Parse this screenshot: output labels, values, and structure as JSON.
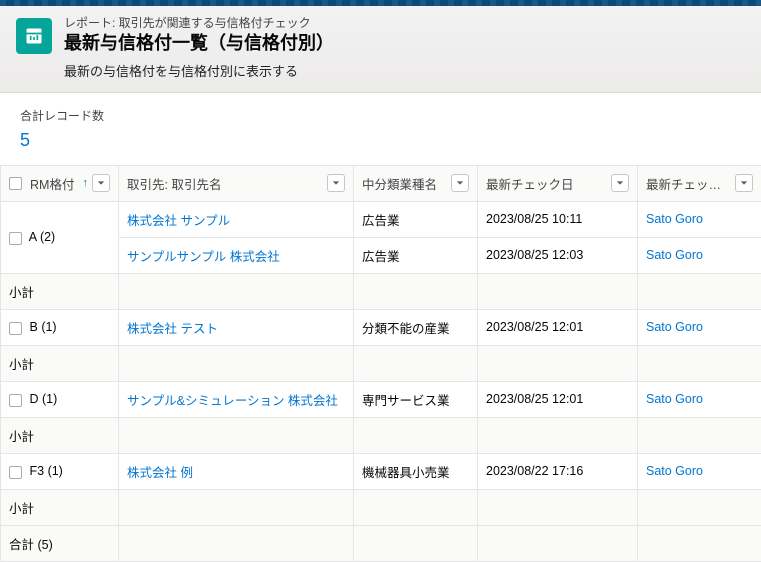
{
  "header": {
    "eyebrow": "レポート: 取引先が関連する与信格付チェック",
    "title": "最新与信格付一覧（与信格付別）",
    "desc": "最新の与信格付を与信格付別に表示する"
  },
  "summary": {
    "label": "合計レコード数",
    "value": "5"
  },
  "columns": {
    "c1": "RM格付",
    "c2": "取引先: 取引先名",
    "c3": "中分類業種名",
    "c4": "最新チェック日",
    "c5": "最新チェックユーザ"
  },
  "labels": {
    "subtotal": "小計",
    "total": "合計"
  },
  "total": {
    "count": "(5)"
  },
  "groups": [
    {
      "name": "A",
      "count": "(2)",
      "rows": [
        {
          "account": "株式会社 サンプル",
          "industry": "広告業",
          "checked": "2023/08/25 10:11",
          "user": "Sato Goro"
        },
        {
          "account": "サンプルサンプル  株式会社",
          "industry": "広告業",
          "checked": "2023/08/25 12:03",
          "user": "Sato Goro"
        }
      ]
    },
    {
      "name": "B",
      "count": "(1)",
      "rows": [
        {
          "account": "株式会社 テスト",
          "industry": "分類不能の産業",
          "checked": "2023/08/25 12:01",
          "user": "Sato Goro"
        }
      ]
    },
    {
      "name": "D",
      "count": "(1)",
      "rows": [
        {
          "account": "サンプル&シミュレーション  株式会社",
          "industry": "専門サービス業",
          "checked": "2023/08/25 12:01",
          "user": "Sato Goro"
        }
      ]
    },
    {
      "name": "F3",
      "count": "(1)",
      "rows": [
        {
          "account": "株式会社 例",
          "industry": "機械器具小売業",
          "checked": "2023/08/22 17:16",
          "user": "Sato Goro"
        }
      ]
    }
  ]
}
